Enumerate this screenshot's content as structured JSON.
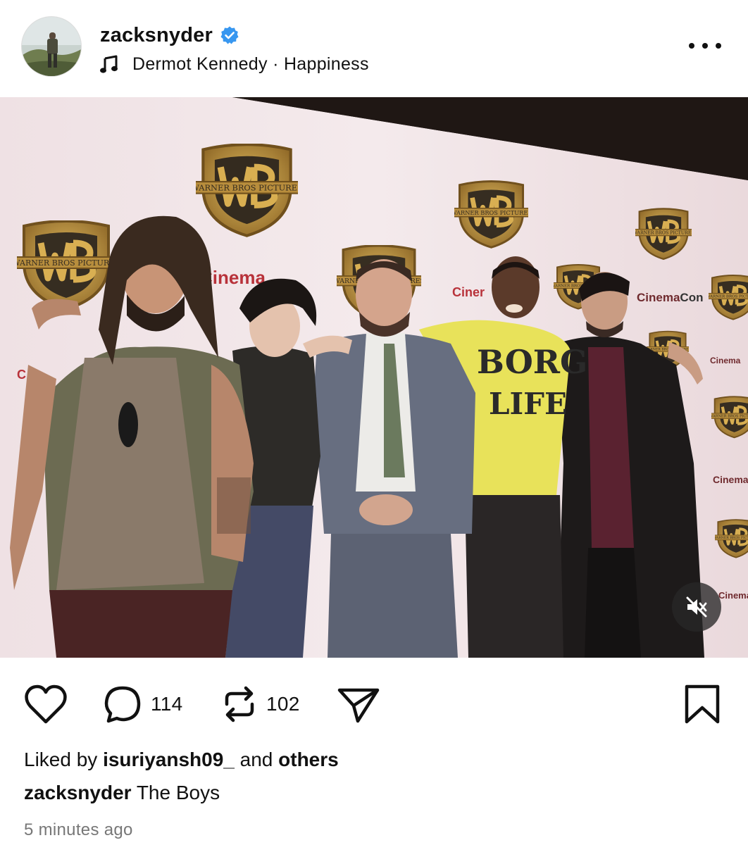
{
  "post": {
    "username": "zacksnyder",
    "verified": true,
    "music": {
      "artist": "Dermot Kennedy",
      "separator": "·",
      "track": "Happiness"
    }
  },
  "media": {
    "backdrop_logos": [
      "WARNER BROS PICTURES",
      "CinemaCon"
    ],
    "shirt_text": [
      "BORG",
      "LIFE"
    ],
    "muted": true
  },
  "actions": {
    "comments_count": "114",
    "reposts_count": "102"
  },
  "likes": {
    "prefix": "Liked by",
    "user": "isuriyansh09_",
    "middle": "and",
    "others": "others"
  },
  "caption": {
    "username": "zacksnyder",
    "text": "The Boys"
  },
  "timestamp": "5 minutes ago",
  "icons": [
    "verified-badge-icon",
    "music-note-icon",
    "more-icon",
    "mute-icon",
    "heart-icon",
    "comment-icon",
    "repost-icon",
    "share-icon",
    "bookmark-icon"
  ],
  "colors": {
    "verified_blue": "#3897f0",
    "text": "#111111",
    "muted_text": "#777777",
    "backdrop": "#f1e6e8",
    "wb_gold": "#c99a3a",
    "shirt_yellow": "#e8e25a"
  }
}
